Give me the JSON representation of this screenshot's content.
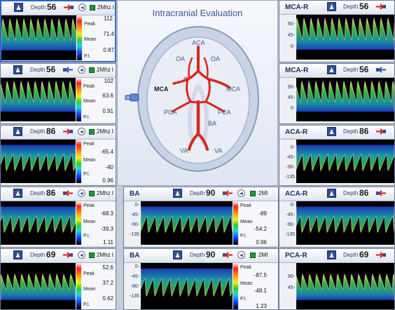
{
  "center": {
    "title": "Intracranial Evaluation",
    "labels": {
      "aca": "ACA",
      "oa_left": "OA",
      "oa_right": "OA",
      "mca_left": "MCA",
      "mca_right": "MCA",
      "pca_left": "PCA",
      "pca_right": "PCA",
      "ba": "BA",
      "va_left": "VA",
      "va_right": "VA"
    }
  },
  "left_panels": [
    {
      "depth_label": "Depth",
      "depth": "56",
      "freq": "2Mhz I",
      "peak_label": "Peak",
      "peak": "112.",
      "mean_label": "Mean",
      "mean": "71.4",
      "pi_label": "P.I.",
      "pi": "0.87"
    },
    {
      "depth_label": "Depth",
      "depth": "56",
      "freq": "2Mhz I",
      "peak_label": "Peak",
      "peak": "102",
      "mean_label": "Mean",
      "mean": "63.6",
      "pi_label": "P.I.",
      "pi": "0.91"
    },
    {
      "depth_label": "Depth",
      "depth": "86",
      "freq": "2Mhz I",
      "peak_label": "Peak",
      "peak": "-65.4",
      "mean_label": "Mean",
      "mean": "-40",
      "pi_label": "P.I.",
      "pi": "0.96"
    },
    {
      "depth_label": "Depth",
      "depth": "86",
      "freq": "2Mhz I",
      "peak_label": "Peak",
      "peak": "-68.3",
      "mean_label": "Mean",
      "mean": "-39.3",
      "pi_label": "P.I.",
      "pi": "1.11"
    },
    {
      "depth_label": "Depth",
      "depth": "69",
      "freq": "2Mhz I",
      "peak_label": "Peak",
      "peak": "52.6",
      "mean_label": "Mean",
      "mean": "37.2",
      "pi_label": "P.I.",
      "pi": "0.62"
    }
  ],
  "mid_panels": [
    {
      "title": "BA",
      "depth_label": "Depth",
      "depth": "90",
      "freq": "2MI",
      "ticks": [
        "0-",
        "-45-",
        "-90-",
        "-135"
      ],
      "peak_label": "Peak",
      "peak": "-89",
      "mean_label": "Mean",
      "mean": "-54.2",
      "pi_label": "P.I.",
      "pi": "0.96"
    },
    {
      "title": "BA",
      "depth_label": "Depth",
      "depth": "90",
      "freq": "2MI",
      "ticks": [
        "0-",
        "-45-",
        "-90-",
        "-135"
      ],
      "peak_label": "Peak",
      "peak": "-87.5",
      "mean_label": "Mean",
      "mean": "-48.1",
      "pi_label": "P.I.",
      "pi": "1.23"
    }
  ],
  "right_panels": [
    {
      "title": "MCA-R",
      "depth_label": "Depth",
      "depth": "56",
      "ticks": [
        "90-",
        "45-",
        "0-"
      ]
    },
    {
      "title": "MCA-R",
      "depth_label": "Depth",
      "depth": "56",
      "ticks": [
        "90-",
        "45-",
        "0-"
      ]
    },
    {
      "title": "ACA-R",
      "depth_label": "Depth",
      "depth": "86",
      "ticks": [
        "0-",
        "-45-",
        "-90-",
        "-135"
      ]
    },
    {
      "title": "ACA-R",
      "depth_label": "Depth",
      "depth": "86",
      "ticks": [
        "0-",
        "-45-",
        "-90-",
        "-135"
      ]
    },
    {
      "title": "PCA-R",
      "depth_label": "Depth",
      "depth": "69",
      "ticks": [
        "90-",
        "45-"
      ]
    }
  ],
  "icons": {
    "patient": "person-icon",
    "probe": "probe-arrow-icon",
    "sound": "speaker-icon",
    "record": "record-indicator-icon",
    "transducer": "transducer-icon"
  },
  "colors": {
    "accent": "#2d67c8",
    "vessel": "#d8261e",
    "title": "#3f5691"
  }
}
